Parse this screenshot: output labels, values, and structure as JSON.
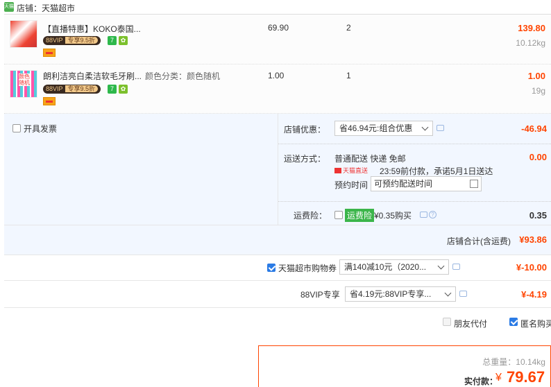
{
  "shop": {
    "icon": "tmall-shop-icon",
    "label": "店铺：天猫超市"
  },
  "items": [
    {
      "title": "【直播特惠】KOKO泰国...",
      "sku": "",
      "vip_badge": "88VIP",
      "vip_discount": "专享9.5折",
      "service_icons": [
        "7",
        "guarantee"
      ],
      "price": "69.90",
      "quantity": "2",
      "subtotal": "139.80",
      "weight": "10.12kg"
    },
    {
      "title": "朗利洁亮白柔洁软毛牙刷...",
      "sku": "颜色分类：颜色随机",
      "thumb_text": "颜色随机",
      "vip_badge": "88VIP",
      "vip_discount": "专享9.5折",
      "service_icons": [
        "7",
        "guarantee"
      ],
      "price": "1.00",
      "quantity": "1",
      "subtotal": "1.00",
      "weight": "19g"
    }
  ],
  "invoice": {
    "label": "开具发票",
    "checked": false
  },
  "shop_discount": {
    "label": "店铺优惠：",
    "selected": "省46.94元:组合优惠",
    "amount": "-46.94"
  },
  "delivery": {
    "label": "运送方式：",
    "method": "普通配送 快递 免邮",
    "tag": "天猫直送",
    "promise": "23:59前付款，承诺5月1日送达",
    "schedule_label": "预约时间",
    "schedule_placeholder": "可预约配送时间",
    "amount": "0.00"
  },
  "shipping_insurance": {
    "label": "运费险：",
    "tag": "运费险",
    "price": "¥0.35购买",
    "amount": "0.35"
  },
  "shop_total": {
    "label": "店铺合计(含运费)",
    "amount": "¥93.86"
  },
  "coupon": {
    "label": "天猫超市购物券",
    "selected": "满140减10元（2020...",
    "amount": "¥-10.00",
    "checked": true
  },
  "vip88": {
    "label": "88VIP专享",
    "selected": "省4.19元:88VIP专享...",
    "amount": "¥-4.19"
  },
  "options": {
    "friend_pay": "朋友代付",
    "anonymous": "匿名购买"
  },
  "summary": {
    "gross_weight": "总重量：10.14kg",
    "pay_label": "实付款：",
    "currency": "¥",
    "pay_amount": "79.67"
  },
  "colors": {
    "accent": "#ff4400",
    "panel": "#f2f7ff",
    "vip_dark": "#3a2a20",
    "vip_gold": "#f2c98a"
  }
}
